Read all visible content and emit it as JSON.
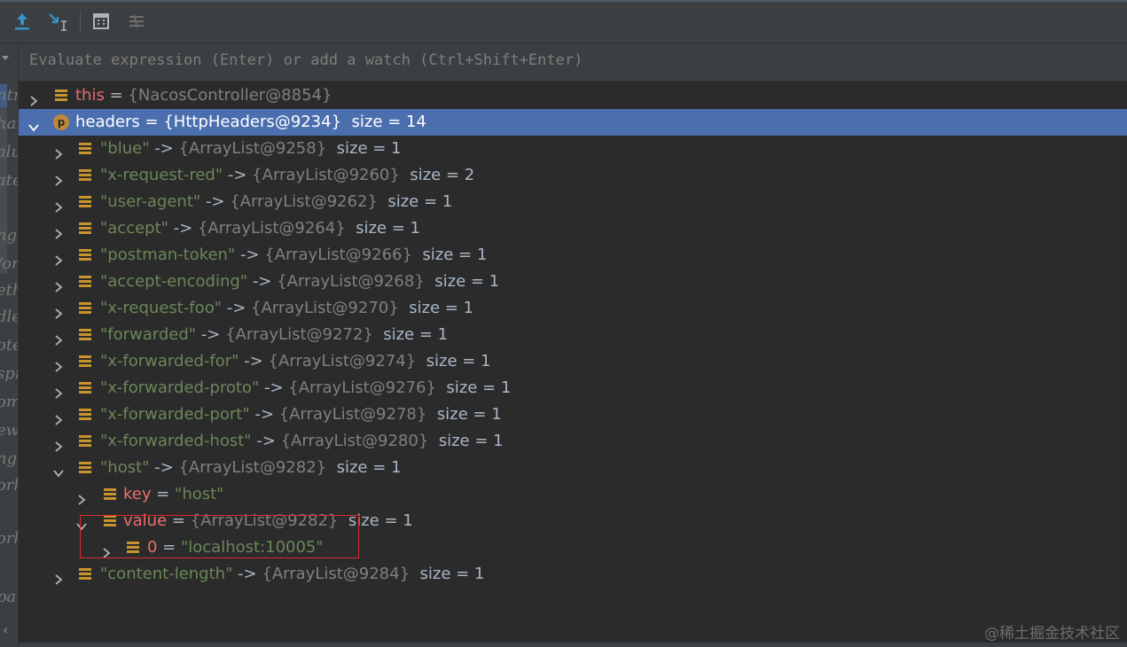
{
  "toolbar": {
    "buttons": [
      {
        "icon": "step-out-icon",
        "color": "#3592c4"
      },
      {
        "icon": "run-to-cursor-icon",
        "color": "#3592c4"
      },
      {
        "icon": "evaluate-expression-icon",
        "color": "#afb1b3"
      },
      {
        "icon": "trace-current-stream-icon",
        "color": "#6e6e6e"
      }
    ]
  },
  "gutter": {
    "fragments": [
      "ntrc",
      "hai",
      "alu",
      "ate",
      "ng",
      "/or",
      "eth",
      "dle",
      "ote",
      "spr",
      "om",
      "ewc",
      "ng",
      "ork",
      "ork",
      "pa"
    ]
  },
  "evaluate": {
    "placeholder": "Evaluate expression (Enter) or add a watch (Ctrl+Shift+Enter)"
  },
  "tree": {
    "this": {
      "name": "this",
      "eq": " = ",
      "value": "{NacosController@8854}"
    },
    "headers": {
      "name": "headers",
      "eq": " = ",
      "value": "{HttpHeaders@9234}",
      "size": "size = 14",
      "badge": "p"
    },
    "entries": [
      {
        "key": "\"blue\"",
        "arrow": " -> ",
        "value": "{ArrayList@9258}",
        "size": "size = 1"
      },
      {
        "key": "\"x-request-red\"",
        "arrow": " -> ",
        "value": "{ArrayList@9260}",
        "size": "size = 2"
      },
      {
        "key": "\"user-agent\"",
        "arrow": " -> ",
        "value": "{ArrayList@9262}",
        "size": "size = 1"
      },
      {
        "key": "\"accept\"",
        "arrow": " -> ",
        "value": "{ArrayList@9264}",
        "size": "size = 1"
      },
      {
        "key": "\"postman-token\"",
        "arrow": " -> ",
        "value": "{ArrayList@9266}",
        "size": "size = 1"
      },
      {
        "key": "\"accept-encoding\"",
        "arrow": " -> ",
        "value": "{ArrayList@9268}",
        "size": "size = 1"
      },
      {
        "key": "\"x-request-foo\"",
        "arrow": " -> ",
        "value": "{ArrayList@9270}",
        "size": "size = 1"
      },
      {
        "key": "\"forwarded\"",
        "arrow": " -> ",
        "value": "{ArrayList@9272}",
        "size": "size = 1"
      },
      {
        "key": "\"x-forwarded-for\"",
        "arrow": " -> ",
        "value": "{ArrayList@9274}",
        "size": "size = 1"
      },
      {
        "key": "\"x-forwarded-proto\"",
        "arrow": " -> ",
        "value": "{ArrayList@9276}",
        "size": "size = 1"
      },
      {
        "key": "\"x-forwarded-port\"",
        "arrow": " -> ",
        "value": "{ArrayList@9278}",
        "size": "size = 1"
      },
      {
        "key": "\"x-forwarded-host\"",
        "arrow": " -> ",
        "value": "{ArrayList@9280}",
        "size": "size = 1"
      }
    ],
    "host": {
      "key": "\"host\"",
      "arrow": " -> ",
      "value": "{ArrayList@9282}",
      "size": "size = 1"
    },
    "host_key": {
      "name": "key",
      "eq": " = ",
      "value": "\"host\""
    },
    "host_value": {
      "name": "value",
      "eq": " = ",
      "value": "{ArrayList@9282}",
      "size": "size = 1"
    },
    "host_item": {
      "name": "0",
      "eq": " = ",
      "value": "\"localhost:10005\""
    },
    "content_length": {
      "key": "\"content-length\"",
      "arrow": " -> ",
      "value": "{ArrayList@9284}",
      "size": "size = 1"
    }
  },
  "watermark": "@稀土掘金技术社区"
}
